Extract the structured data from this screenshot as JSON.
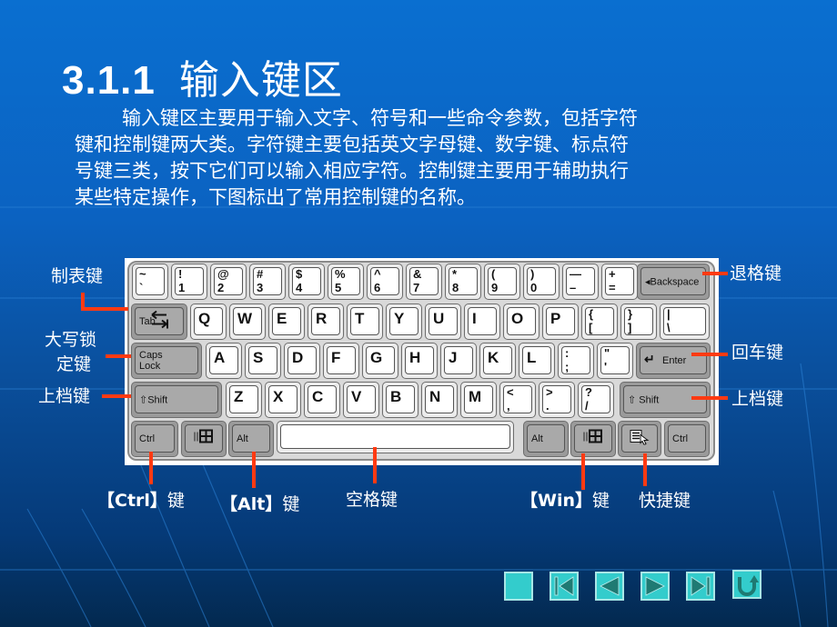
{
  "slide": {
    "section_number": "3.1.1",
    "title": "输入键区",
    "paragraph_lines": [
      "输入键区主要用于输入文字、符号和一些命令参数，包括字符",
      "键和控制键两大类。字符键主要包括英文字母键、数字键、标点符",
      "号键三类，按下它们可以输入相应字符。控制键主要用于辅助执行",
      "某些特定操作，下图标出了常用控制键的名称。"
    ]
  },
  "keyboard": {
    "row1": [
      {
        "top": "~",
        "bottom": "`"
      },
      {
        "top": "!",
        "bottom": "1"
      },
      {
        "top": "@",
        "bottom": "2"
      },
      {
        "top": "#",
        "bottom": "3"
      },
      {
        "top": "$",
        "bottom": "4"
      },
      {
        "top": "%",
        "bottom": "5"
      },
      {
        "top": "^",
        "bottom": "6"
      },
      {
        "top": "&",
        "bottom": "7"
      },
      {
        "top": "*",
        "bottom": "8"
      },
      {
        "top": "(",
        "bottom": "9"
      },
      {
        "top": ")",
        "bottom": "0"
      },
      {
        "top": "—",
        "bottom": "–"
      },
      {
        "top": "+",
        "bottom": "="
      }
    ],
    "backspace": "◂Backspace",
    "tab": "Tab",
    "row2": [
      "Q",
      "W",
      "E",
      "R",
      "T",
      "Y",
      "U",
      "I",
      "O",
      "P"
    ],
    "row2_sym": [
      {
        "top": "{",
        "bottom": "["
      },
      {
        "top": "}",
        "bottom": "]"
      },
      {
        "top": "|",
        "bottom": "\\"
      }
    ],
    "caps_lock_line1": "Caps",
    "caps_lock_line2": "Lock",
    "row3": [
      "A",
      "S",
      "D",
      "F",
      "G",
      "H",
      "J",
      "K",
      "L"
    ],
    "row3_sym": [
      {
        "top": ":",
        "bottom": ";"
      },
      {
        "top": "\"",
        "bottom": "'"
      }
    ],
    "enter": "Enter",
    "shift_left": "⇧Shift",
    "row4": [
      "Z",
      "X",
      "C",
      "V",
      "B",
      "N",
      "M"
    ],
    "row4_sym": [
      {
        "top": "<",
        "bottom": ","
      },
      {
        "top": ">",
        "bottom": "."
      },
      {
        "top": "?",
        "bottom": "/"
      }
    ],
    "shift_right": "⇧ Shift",
    "ctrl_left": "Ctrl",
    "alt_left": "Alt",
    "alt_right": "Alt",
    "ctrl_right": "Ctrl"
  },
  "annotations": {
    "tab": "制表键",
    "caps_line1": "大写锁",
    "caps_line2": "定键",
    "shift_left": "上档键",
    "backspace": "退格键",
    "enter": "回车键",
    "shift_right": "上档键",
    "ctrl_key": "【Ctrl】",
    "ctrl_suffix": "键",
    "alt_key": "【Alt】",
    "alt_suffix": "键",
    "space": "空格键",
    "win_key": "【Win】",
    "win_suffix": "键",
    "menu": "快捷键"
  },
  "navigation": {
    "buttons": [
      "blank",
      "first-slide",
      "previous-slide",
      "next-slide",
      "last-slide",
      "return"
    ]
  },
  "colors": {
    "leader": "#ff3a12",
    "nav_fill": "#33cccc",
    "nav_glyph": "#1f7a73"
  }
}
